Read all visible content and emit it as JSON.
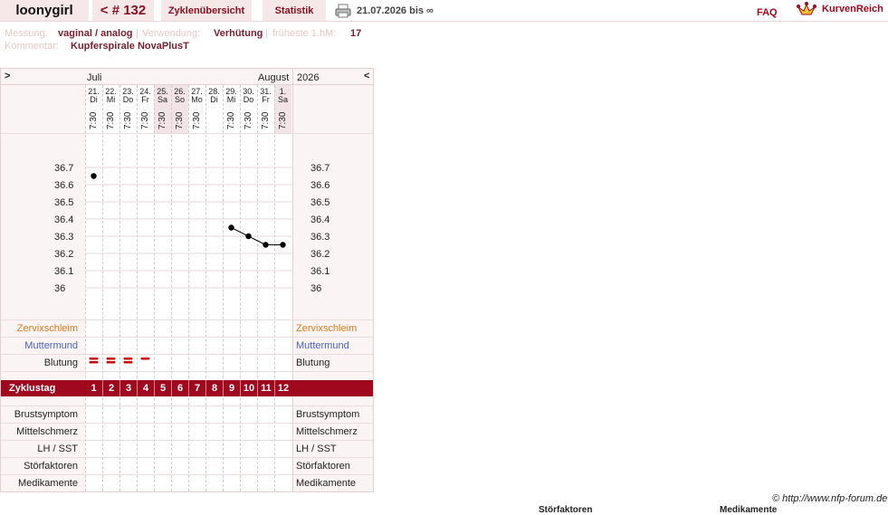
{
  "header": {
    "username": "loonygirl",
    "cycle_nav": "< # 132",
    "tab_overview": "Zyklenübersicht",
    "tab_stats": "Statistik",
    "date_range": "21.07.2026 bis ∞",
    "faq": "FAQ",
    "brand": "KurvenReich"
  },
  "meta": {
    "measure_label": "Messung:",
    "measure_value": "vaginal / analog",
    "use_label": "Verwendung:",
    "use_value": "Verhütung",
    "earliest_label": "früheste 1.hM:",
    "earliest_value": "17",
    "comment_label": "Kommentar:",
    "comment_value": "Kupferspirale NovaPlusT"
  },
  "nav": {
    "prev": ">",
    "next": "<",
    "month1": "Juli",
    "month2": "August",
    "year": "2026"
  },
  "days": [
    {
      "d": "21.",
      "w": "Di",
      "t": "7:30",
      "weekend": false
    },
    {
      "d": "22.",
      "w": "Mi",
      "t": "7:30",
      "weekend": false
    },
    {
      "d": "23.",
      "w": "Do",
      "t": "7:30",
      "weekend": false
    },
    {
      "d": "24.",
      "w": "Fr",
      "t": "7:30",
      "weekend": false
    },
    {
      "d": "25.",
      "w": "Sa",
      "t": "7:30",
      "weekend": true
    },
    {
      "d": "26.",
      "w": "So",
      "t": "7:30",
      "weekend": true
    },
    {
      "d": "27.",
      "w": "Mo",
      "t": "7:30",
      "weekend": false
    },
    {
      "d": "28.",
      "w": "Di",
      "t": "",
      "weekend": false
    },
    {
      "d": "29.",
      "w": "Mi",
      "t": "7:30",
      "weekend": false
    },
    {
      "d": "30.",
      "w": "Do",
      "t": "7:30",
      "weekend": false
    },
    {
      "d": "31.",
      "w": "Fr",
      "t": "7:30",
      "weekend": false
    },
    {
      "d": "1.",
      "w": "Sa",
      "t": "7:30",
      "weekend": true
    }
  ],
  "rows": {
    "cervix": "Zervixschleim",
    "cervix_color": "#e07a1c",
    "os": "Muttermund",
    "os_color": "#4a5fc1",
    "bleeding": "Blutung",
    "cycle_day": "Zyklustag",
    "breast": "Brustsymptom",
    "midpain": "Mittelschmerz",
    "lh": "LH / SST",
    "disturb": "Störfaktoren",
    "meds": "Medikamente"
  },
  "footer": {
    "credit": "© http://www.nfp-forum.de",
    "cut1": "Störfaktoren",
    "cut2": "Medikamente"
  },
  "colors": {
    "accent": "#a0081e",
    "tab_bg": "#f6e8e8",
    "weekend": "#f2e4e6",
    "bleeding": "#cc0000"
  },
  "chart_data": {
    "type": "line",
    "title": "",
    "xlabel": "",
    "ylabel": "",
    "y_ticks": [
      "36.7",
      "36.6",
      "36.5",
      "36.4",
      "36.3",
      "36.2",
      "36.1",
      "36"
    ],
    "ylim": [
      36.0,
      36.7
    ],
    "categories": [
      "21.",
      "22.",
      "23.",
      "24.",
      "25.",
      "26.",
      "27.",
      "28.",
      "29.",
      "30.",
      "31.",
      "1."
    ],
    "series": [
      {
        "values": [
          36.65,
          null,
          null,
          null,
          null,
          null,
          null,
          null,
          36.35,
          36.3,
          36.25,
          36.25
        ]
      }
    ],
    "bleeding": [
      2,
      2,
      2,
      1,
      0,
      0,
      0,
      0,
      0,
      0,
      0,
      0
    ],
    "cycle_days": [
      "1",
      "2",
      "3",
      "4",
      "5",
      "6",
      "7",
      "8",
      "9",
      "10",
      "11",
      "12"
    ],
    "grid": true
  }
}
